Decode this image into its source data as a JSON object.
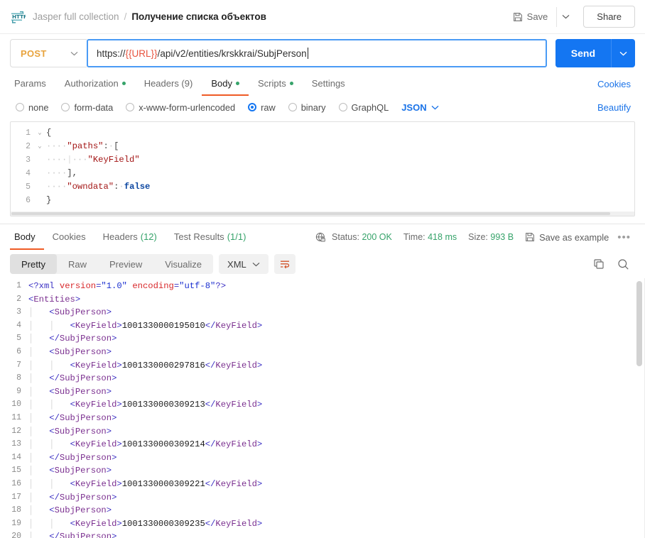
{
  "header": {
    "icon": "http-icon",
    "collection": "Jasper full collection",
    "separator": "/",
    "request_name": "Получение списка объектов",
    "save_label": "Save",
    "save_icon": "floppy-disk-icon",
    "save_caret_icon": "chevron-down-icon",
    "share_label": "Share"
  },
  "url_bar": {
    "method": "POST",
    "method_caret_icon": "chevron-down-icon",
    "url_prefix": "https://",
    "url_variable": "{{URL}}",
    "url_suffix": "/api/v2/entities/krskkrai/SubjPerson",
    "url_full": "https://{{URL}}/api/v2/entities/krskkrai/SubjPerson",
    "send_label": "Send",
    "send_caret_icon": "chevron-down-icon"
  },
  "request_tabs": {
    "items": [
      {
        "label": "Params",
        "dot": false,
        "active": false
      },
      {
        "label": "Authorization",
        "dot": true,
        "active": false
      },
      {
        "label": "Headers (9)",
        "dot": false,
        "active": false
      },
      {
        "label": "Body",
        "dot": true,
        "active": true
      },
      {
        "label": "Scripts",
        "dot": true,
        "active": false
      },
      {
        "label": "Settings",
        "dot": false,
        "active": false
      }
    ],
    "cookies_link": "Cookies"
  },
  "body_type": {
    "options": [
      {
        "label": "none",
        "selected": false
      },
      {
        "label": "form-data",
        "selected": false
      },
      {
        "label": "x-www-form-urlencoded",
        "selected": false
      },
      {
        "label": "raw",
        "selected": true
      },
      {
        "label": "binary",
        "selected": false
      },
      {
        "label": "GraphQL",
        "selected": false
      }
    ],
    "format": "JSON",
    "format_caret_icon": "chevron-down-icon",
    "beautify_link": "Beautify"
  },
  "request_body": {
    "lines": [
      {
        "n": "1",
        "fold": "v",
        "text": "{"
      },
      {
        "n": "2",
        "fold": "v",
        "text": "    \"paths\": ["
      },
      {
        "n": "3",
        "fold": "",
        "text": "        \"KeyField\""
      },
      {
        "n": "4",
        "fold": "",
        "text": "    ],"
      },
      {
        "n": "5",
        "fold": "",
        "text": "    \"owndata\": false"
      },
      {
        "n": "6",
        "fold": "",
        "text": "}"
      }
    ]
  },
  "response_tabs": {
    "items": [
      {
        "label": "Body",
        "count": "",
        "active": true
      },
      {
        "label": "Cookies",
        "count": "",
        "active": false
      },
      {
        "label": "Headers",
        "count": "(12)",
        "active": false
      },
      {
        "label": "Test Results",
        "count": "(1/1)",
        "active": false
      }
    ],
    "security_icon": "globe-lock-icon",
    "status_label": "Status:",
    "status_value": "200 OK",
    "time_label": "Time:",
    "time_value": "418 ms",
    "size_label": "Size:",
    "size_value": "993 B",
    "save_example_icon": "floppy-disk-icon",
    "save_example_label": "Save as example",
    "more_label": "•••"
  },
  "response_toolbar": {
    "views": [
      {
        "label": "Pretty",
        "active": true
      },
      {
        "label": "Raw",
        "active": false
      },
      {
        "label": "Preview",
        "active": false
      },
      {
        "label": "Visualize",
        "active": false
      }
    ],
    "format": "XML",
    "format_caret_icon": "chevron-down-icon",
    "wrap_icon": "word-wrap-icon",
    "copy_icon": "copy-icon",
    "search_icon": "search-icon"
  },
  "response_body": {
    "lines": [
      {
        "n": "1",
        "indent": 0,
        "type": "decl"
      },
      {
        "n": "2",
        "indent": 0,
        "type": "open",
        "tag": "Entities"
      },
      {
        "n": "3",
        "indent": 1,
        "type": "open",
        "tag": "SubjPerson"
      },
      {
        "n": "4",
        "indent": 2,
        "type": "leaf",
        "tag": "KeyField",
        "value": "1001330000195010"
      },
      {
        "n": "5",
        "indent": 1,
        "type": "close",
        "tag": "SubjPerson"
      },
      {
        "n": "6",
        "indent": 1,
        "type": "open",
        "tag": "SubjPerson"
      },
      {
        "n": "7",
        "indent": 2,
        "type": "leaf",
        "tag": "KeyField",
        "value": "1001330000297816"
      },
      {
        "n": "8",
        "indent": 1,
        "type": "close",
        "tag": "SubjPerson"
      },
      {
        "n": "9",
        "indent": 1,
        "type": "open",
        "tag": "SubjPerson"
      },
      {
        "n": "10",
        "indent": 2,
        "type": "leaf",
        "tag": "KeyField",
        "value": "1001330000309213"
      },
      {
        "n": "11",
        "indent": 1,
        "type": "close",
        "tag": "SubjPerson"
      },
      {
        "n": "12",
        "indent": 1,
        "type": "open",
        "tag": "SubjPerson"
      },
      {
        "n": "13",
        "indent": 2,
        "type": "leaf",
        "tag": "KeyField",
        "value": "1001330000309214"
      },
      {
        "n": "14",
        "indent": 1,
        "type": "close",
        "tag": "SubjPerson"
      },
      {
        "n": "15",
        "indent": 1,
        "type": "open",
        "tag": "SubjPerson"
      },
      {
        "n": "16",
        "indent": 2,
        "type": "leaf",
        "tag": "KeyField",
        "value": "1001330000309221"
      },
      {
        "n": "17",
        "indent": 1,
        "type": "close",
        "tag": "SubjPerson"
      },
      {
        "n": "18",
        "indent": 1,
        "type": "open",
        "tag": "SubjPerson"
      },
      {
        "n": "19",
        "indent": 2,
        "type": "leaf",
        "tag": "KeyField",
        "value": "1001330000309235"
      },
      {
        "n": "20",
        "indent": 1,
        "type": "close",
        "tag": "SubjPerson"
      }
    ],
    "xml_declaration": {
      "prefix": "<?xml ",
      "attr1_name": "version",
      "attr1_value": "\"1.0\"",
      "attr2_name": "encoding",
      "attr2_value": "\"utf-8\"",
      "suffix": "?>"
    }
  },
  "colors": {
    "accent_blue": "#1476f2",
    "active_orange": "#ef5b25",
    "method_orange": "#e8a33d",
    "status_green": "#36a36a",
    "link_blue": "#1a73e8",
    "var_red": "#e8543f"
  }
}
